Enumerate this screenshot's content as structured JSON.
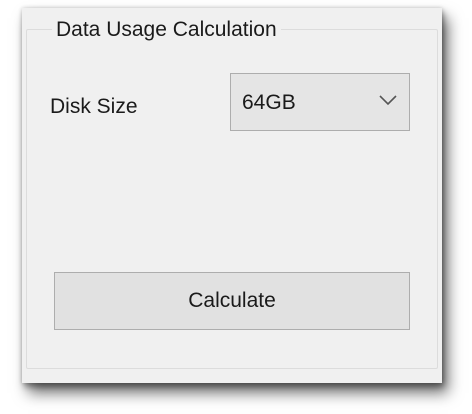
{
  "group": {
    "title": "Data Usage Calculation"
  },
  "disk": {
    "label": "Disk Size",
    "selected": "64GB",
    "dropdown_icon": "chevron-down-icon"
  },
  "actions": {
    "calculate_label": "Calculate"
  }
}
